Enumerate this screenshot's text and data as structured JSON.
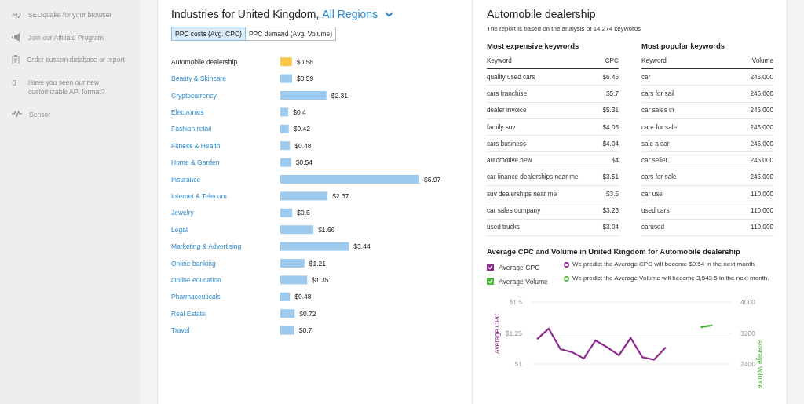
{
  "sidebar": {
    "items": [
      {
        "kind": "glyph",
        "glyph": "SQ",
        "label": "SEOquake for your browser"
      },
      {
        "kind": "megaphone",
        "label": "Join our Affiliate Program"
      },
      {
        "kind": "clipboard",
        "label": "Order custom database or report"
      },
      {
        "kind": "glyph",
        "glyph": "{}",
        "label": "Have you seen our new customizable API format?"
      },
      {
        "kind": "pulse",
        "label": "Sensor"
      }
    ]
  },
  "industries": {
    "title": "Industries for United Kingdom,",
    "region": "All Regions",
    "tabs": [
      {
        "label": "PPC costs (Avg. CPC)",
        "selected": true
      },
      {
        "label": "PPC demand (Avg. Volume)",
        "selected": false
      }
    ],
    "chart_data": {
      "type": "bar",
      "orientation": "horizontal",
      "categories": [
        "Automobile dealership",
        "Beauty & Skincare",
        "Cryptocurrency",
        "Electronics",
        "Fashion retail",
        "Fitness & Health",
        "Home & Garden",
        "Insurance",
        "Internet & Telecom",
        "Jewelry",
        "Legal",
        "Marketing & Advertising",
        "Online banking",
        "Online education",
        "Pharmaceuticals",
        "Real Estate",
        "Travel"
      ],
      "values": [
        0.58,
        0.59,
        2.31,
        0.4,
        0.42,
        0.48,
        0.54,
        6.97,
        2.37,
        0.6,
        1.66,
        3.44,
        1.21,
        1.35,
        0.48,
        0.72,
        0.7
      ],
      "value_labels": [
        "$0.58",
        "$0.59",
        "$2.31",
        "$0.4",
        "$0.42",
        "$0.48",
        "$0.54",
        "$6.97",
        "$2.37",
        "$0.6",
        "$1.66",
        "$3.44",
        "$1.21",
        "$1.35",
        "$0.48",
        "$0.72",
        "$0.7"
      ],
      "colors": [
        "#fbc748",
        "#9ccbef",
        "#9ccbef",
        "#9ccbef",
        "#9ccbef",
        "#9ccbef",
        "#9ccbef",
        "#9ccbef",
        "#9ccbef",
        "#9ccbef",
        "#9ccbef",
        "#9ccbef",
        "#9ccbef",
        "#9ccbef",
        "#9ccbef",
        "#9ccbef",
        "#9ccbef"
      ]
    }
  },
  "report": {
    "title": "Automobile dealership",
    "subtitle": "The report is based on the analysis of 14,274 keywords",
    "tables": [
      {
        "title": "Most expensive keywords",
        "columns": [
          "Keyword",
          "CPC"
        ],
        "rows": [
          [
            "quality used cars",
            "$6.46"
          ],
          [
            "cars franchise",
            "$5.7"
          ],
          [
            "dealer invoice",
            "$5.31"
          ],
          [
            "family suv",
            "$4.05"
          ],
          [
            "cars business",
            "$4.04"
          ],
          [
            "automotive new",
            "$4"
          ],
          [
            "car finance dealerships near me",
            "$3.51"
          ],
          [
            "suv dealerships near me",
            "$3.5"
          ],
          [
            "car sales company",
            "$3.23"
          ],
          [
            "used trucks",
            "$3.04"
          ]
        ]
      },
      {
        "title": "Most popular keywords",
        "columns": [
          "Keyword",
          "Volume"
        ],
        "rows": [
          [
            "car",
            "246,000"
          ],
          [
            "cars for sail",
            "246,000"
          ],
          [
            "car sales in",
            "246,000"
          ],
          [
            "care for sale",
            "246,000"
          ],
          [
            "sale a car",
            "246,000"
          ],
          [
            "car seller",
            "246,000"
          ],
          [
            "cars for sale",
            "246,000"
          ],
          [
            "car use",
            "110,000"
          ],
          [
            "used cars",
            "110,000"
          ],
          [
            "carused",
            "110,000"
          ]
        ]
      }
    ],
    "trend": {
      "title": "Average CPC and Volume in United Kingdom for Automobile dealership",
      "legend": [
        {
          "checked": true
        },
        {
          "checked": true
        }
      ],
      "predictions": [
        {
          "text": "We predict the Average CPC will become $0.54 in the next month.",
          "color": "#8e2a8e"
        },
        {
          "text": "We predict the Average Volume will become 3,543.5 in the next month.",
          "color": "#4db53b"
        }
      ],
      "chart_data": {
        "type": "line",
        "ylabel": "Average CPC",
        "y2label": "Average Volume",
        "ylim": [
          1,
          1.5
        ],
        "yticks": [
          {
            "value": 1,
            "label": "$1"
          },
          {
            "value": 1.25,
            "label": "$1.25"
          },
          {
            "value": 1.5,
            "label": "$1.5"
          }
        ],
        "y2lim": [
          2400,
          4000
        ],
        "y2ticks": [
          2400,
          3200,
          4000
        ],
        "series": [
          {
            "name": "Average CPC",
            "color": "#8e2a8e",
            "values": [
              1.2,
              1.285,
              1.12,
              1.095,
              1.045,
              1.19,
              1.135,
              1.07,
              1.21,
              1.055,
              1.035,
              1.135,
              null,
              null,
              null,
              null
            ]
          },
          {
            "name": "Average Volume",
            "color": "#4db53b",
            "axis": "y2",
            "values": [
              null,
              null,
              null,
              null,
              null,
              null,
              null,
              null,
              null,
              null,
              null,
              null,
              null,
              null,
              3350,
              3400
            ]
          }
        ]
      }
    }
  }
}
